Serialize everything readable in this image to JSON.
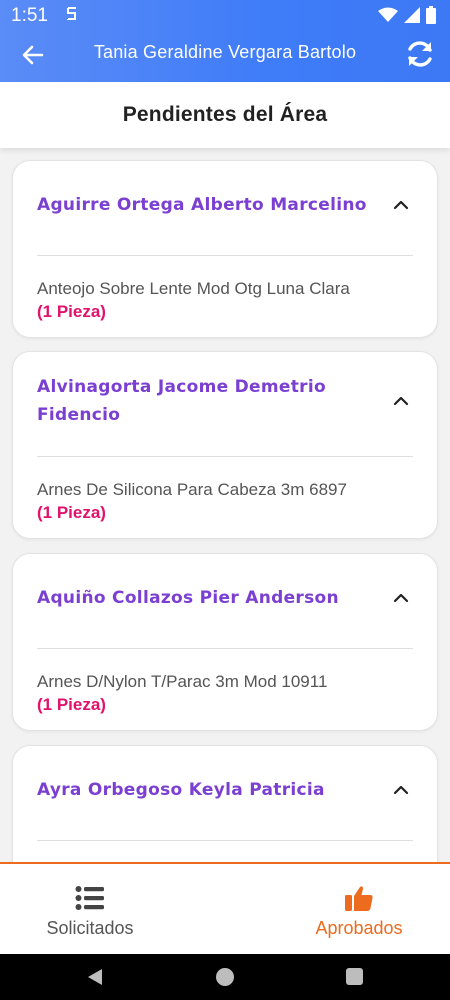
{
  "status_bar": {
    "time": "1:51"
  },
  "app_bar": {
    "title": "Tania Geraldine Vergara Bartolo"
  },
  "page": {
    "title": "Pendientes del Área"
  },
  "cards": [
    {
      "name": "Aguirre Ortega Alberto Marcelino",
      "item": "Anteojo Sobre Lente Mod Otg Luna Clara",
      "qty": "(1 Pieza)"
    },
    {
      "name": "Alvinagorta Jacome Demetrio Fidencio",
      "item": "Arnes De Silicona Para Cabeza 3m 6897",
      "qty": "(1 Pieza)"
    },
    {
      "name": "Aquiño Collazos Pier Anderson",
      "item": "Arnes D/Nylon T/Parac 3m Mod 10911",
      "qty": "(1 Pieza)"
    },
    {
      "name": "Ayra Orbegoso Keyla Patricia",
      "item": "",
      "qty": ""
    }
  ],
  "bottom_nav": {
    "items": [
      {
        "label": "Solicitados",
        "icon": "list-icon",
        "active": false
      },
      {
        "label": "Aprobados",
        "icon": "thumbs-up-icon",
        "active": true
      }
    ]
  },
  "colors": {
    "header_gradient_start": "#5b8cf7",
    "header_gradient_end": "#3d78f5",
    "name_purple": "#7b3fd1",
    "qty_pink": "#e0126b",
    "accent_orange": "#ec6b1f"
  }
}
